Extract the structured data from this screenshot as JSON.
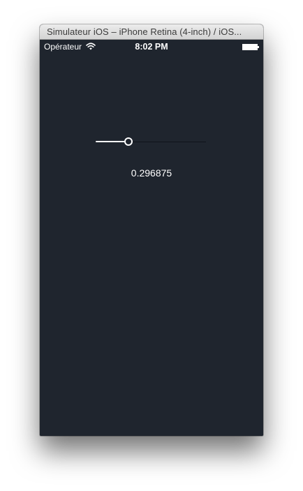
{
  "window": {
    "title": "Simulateur iOS – iPhone Retina (4-inch) / iOS..."
  },
  "status_bar": {
    "carrier": "Opérateur",
    "wifi_icon": "wifi-icon",
    "time": "8:02 PM",
    "battery_icon": "battery-icon"
  },
  "slider": {
    "value": 0.296875,
    "min": 0,
    "max": 1
  },
  "value_label": "0.296875",
  "colors": {
    "background": "#1f252e",
    "track_min": "#ffffff",
    "track_max": "#0f141a",
    "text": "#ffffff"
  }
}
